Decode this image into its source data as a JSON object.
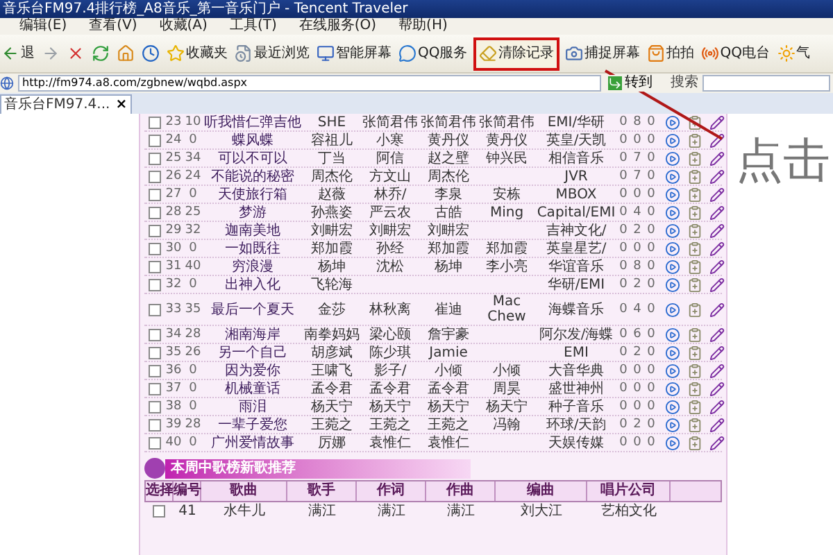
{
  "window": {
    "title": "音乐台FM97.4排行榜_A8音乐_第一音乐门户 - Tencent Traveler"
  },
  "menu": [
    "编辑(E)",
    "查看(V)",
    "收藏(A)",
    "工具(T)",
    "在线服务(O)",
    "帮助(H)"
  ],
  "toolbar": [
    {
      "kind": "back",
      "label": "退",
      "circled": false
    },
    {
      "kind": "forward",
      "circled": false
    },
    {
      "kind": "stop",
      "circled": false
    },
    {
      "kind": "refresh",
      "circled": false
    },
    {
      "kind": "home",
      "circled": false
    },
    {
      "kind": "history",
      "circled": false
    },
    {
      "kind": "favorites",
      "label": "收藏夹",
      "circled": false
    },
    {
      "kind": "recent",
      "label": "最近浏览",
      "circled": false
    },
    {
      "kind": "screen",
      "label": "智能屏幕",
      "circled": false
    },
    {
      "kind": "qq",
      "label": "QQ服务",
      "circled": false
    },
    {
      "kind": "clear",
      "label": "清除记录",
      "circled": true
    },
    {
      "kind": "capture",
      "label": "捕捉屏幕",
      "circled": false
    },
    {
      "kind": "paipai",
      "label": "拍拍",
      "circled": false
    },
    {
      "kind": "radio",
      "label": "QQ电台",
      "circled": false
    },
    {
      "kind": "weather",
      "label": "气",
      "circled": false
    }
  ],
  "address_bar": {
    "url": "http://fm974.a8.com/zgbnew/wqbd.aspx",
    "go_button": "转到",
    "search_label": "搜索"
  },
  "tab": {
    "label": "音乐台FM97.4...",
    "close": "×"
  },
  "chart_table": {
    "rows": [
      {
        "checked": false,
        "cells": [
          "23",
          "10",
          "听我惜仁弹吉他",
          "SHE",
          "张简君伟",
          "张简君伟",
          "张简君伟",
          "EMI/华研",
          "0",
          "8",
          "0"
        ]
      },
      {
        "checked": false,
        "cells": [
          "24",
          "0",
          "蝶风蝶",
          "容祖儿",
          "小寒",
          "黄丹仪",
          "黄丹仪",
          "英皇/天凯",
          "0",
          "0",
          "0"
        ]
      },
      {
        "checked": false,
        "cells": [
          "25",
          "34",
          "可以不可以",
          "丁当",
          "阿信",
          "赵之壁",
          "钟兴民",
          "相信音乐",
          "0",
          "7",
          "0"
        ]
      },
      {
        "checked": false,
        "cells": [
          "26",
          "24",
          "不能说的秘密",
          "周杰伦",
          "方文山",
          "周杰伦",
          "",
          "JVR",
          "0",
          "7",
          "0"
        ]
      },
      {
        "checked": false,
        "cells": [
          "27",
          "0",
          "天使旅行箱",
          "赵薇",
          "林乔/",
          "李泉",
          "安栋",
          "MBOX",
          "0",
          "0",
          "0"
        ]
      },
      {
        "checked": false,
        "cells": [
          "28",
          "25",
          "梦游",
          "孙燕姿",
          "严云农",
          "古皓",
          "Ming",
          "Capital/EMI",
          "0",
          "4",
          "0"
        ]
      },
      {
        "checked": false,
        "cells": [
          "29",
          "32",
          "迦南美地",
          "刘畊宏",
          "刘畊宏",
          "刘畊宏",
          "",
          "吉神文化/",
          "0",
          "2",
          "0"
        ]
      },
      {
        "checked": false,
        "cells": [
          "30",
          "0",
          "一如既往",
          "郑加霞",
          "孙经",
          "郑加霞",
          "郑加霞",
          "英皇星艺/",
          "0",
          "0",
          "0"
        ]
      },
      {
        "checked": false,
        "cells": [
          "31",
          "40",
          "穷浪漫",
          "杨坤",
          "沈松",
          "杨坤",
          "李小亮",
          "华谊音乐",
          "0",
          "8",
          "0"
        ]
      },
      {
        "checked": false,
        "cells": [
          "32",
          "0",
          "出神入化",
          "飞轮海",
          "",
          "",
          "",
          "华研/EMI",
          "0",
          "2",
          "0"
        ]
      },
      {
        "checked": false,
        "cells": [
          "33",
          "35",
          "最后一个夏天",
          "金莎",
          "林秋离",
          "崔迪",
          "Mac Chew",
          "海蝶音乐",
          "0",
          "4",
          "0"
        ]
      },
      {
        "checked": false,
        "cells": [
          "34",
          "28",
          "湘南海岸",
          "南拳妈妈",
          "梁心颐",
          "詹宇豪",
          "",
          "阿尔发/海蝶",
          "0",
          "6",
          "0"
        ]
      },
      {
        "checked": false,
        "cells": [
          "35",
          "26",
          "另一个自己",
          "胡彦斌",
          "陈少琪",
          "Jamie",
          "",
          "EMI",
          "0",
          "2",
          "0"
        ]
      },
      {
        "checked": false,
        "cells": [
          "36",
          "0",
          "因为爱你",
          "王啸飞",
          "影子/",
          "小倾",
          "小倾",
          "大音华典",
          "0",
          "0",
          "0"
        ]
      },
      {
        "checked": false,
        "cells": [
          "37",
          "0",
          "机械童话",
          "孟令君",
          "孟令君",
          "孟令君",
          "周昊",
          "盛世神州",
          "0",
          "0",
          "0"
        ]
      },
      {
        "checked": false,
        "cells": [
          "38",
          "0",
          "雨泪",
          "杨天宁",
          "杨天宁",
          "杨天宁",
          "杨天宁",
          "种子音乐",
          "0",
          "0",
          "0"
        ]
      },
      {
        "checked": false,
        "cells": [
          "39",
          "28",
          "一辈子爱您",
          "王菀之",
          "王菀之",
          "王菀之",
          "冯翰",
          "环球/天韵",
          "0",
          "2",
          "0"
        ]
      },
      {
        "checked": false,
        "cells": [
          "40",
          "0",
          "广州爱情故事",
          "厉娜",
          "袁惟仁",
          "袁惟仁",
          "",
          "天娱传媒",
          "0",
          "0",
          "0"
        ]
      }
    ]
  },
  "new_songs": {
    "title": "本周中歌榜新歌推荐",
    "columns": [
      "选择",
      "编号",
      "歌曲",
      "歌手",
      "作词",
      "作曲",
      "编曲",
      "唱片公司"
    ],
    "rows": [
      {
        "checked": false,
        "cells": [
          "",
          "41",
          "水牛儿",
          "满江",
          "满江",
          "满江",
          "刘大江",
          "艺柏文化"
        ]
      }
    ]
  },
  "annotation": {
    "note": "点击"
  }
}
